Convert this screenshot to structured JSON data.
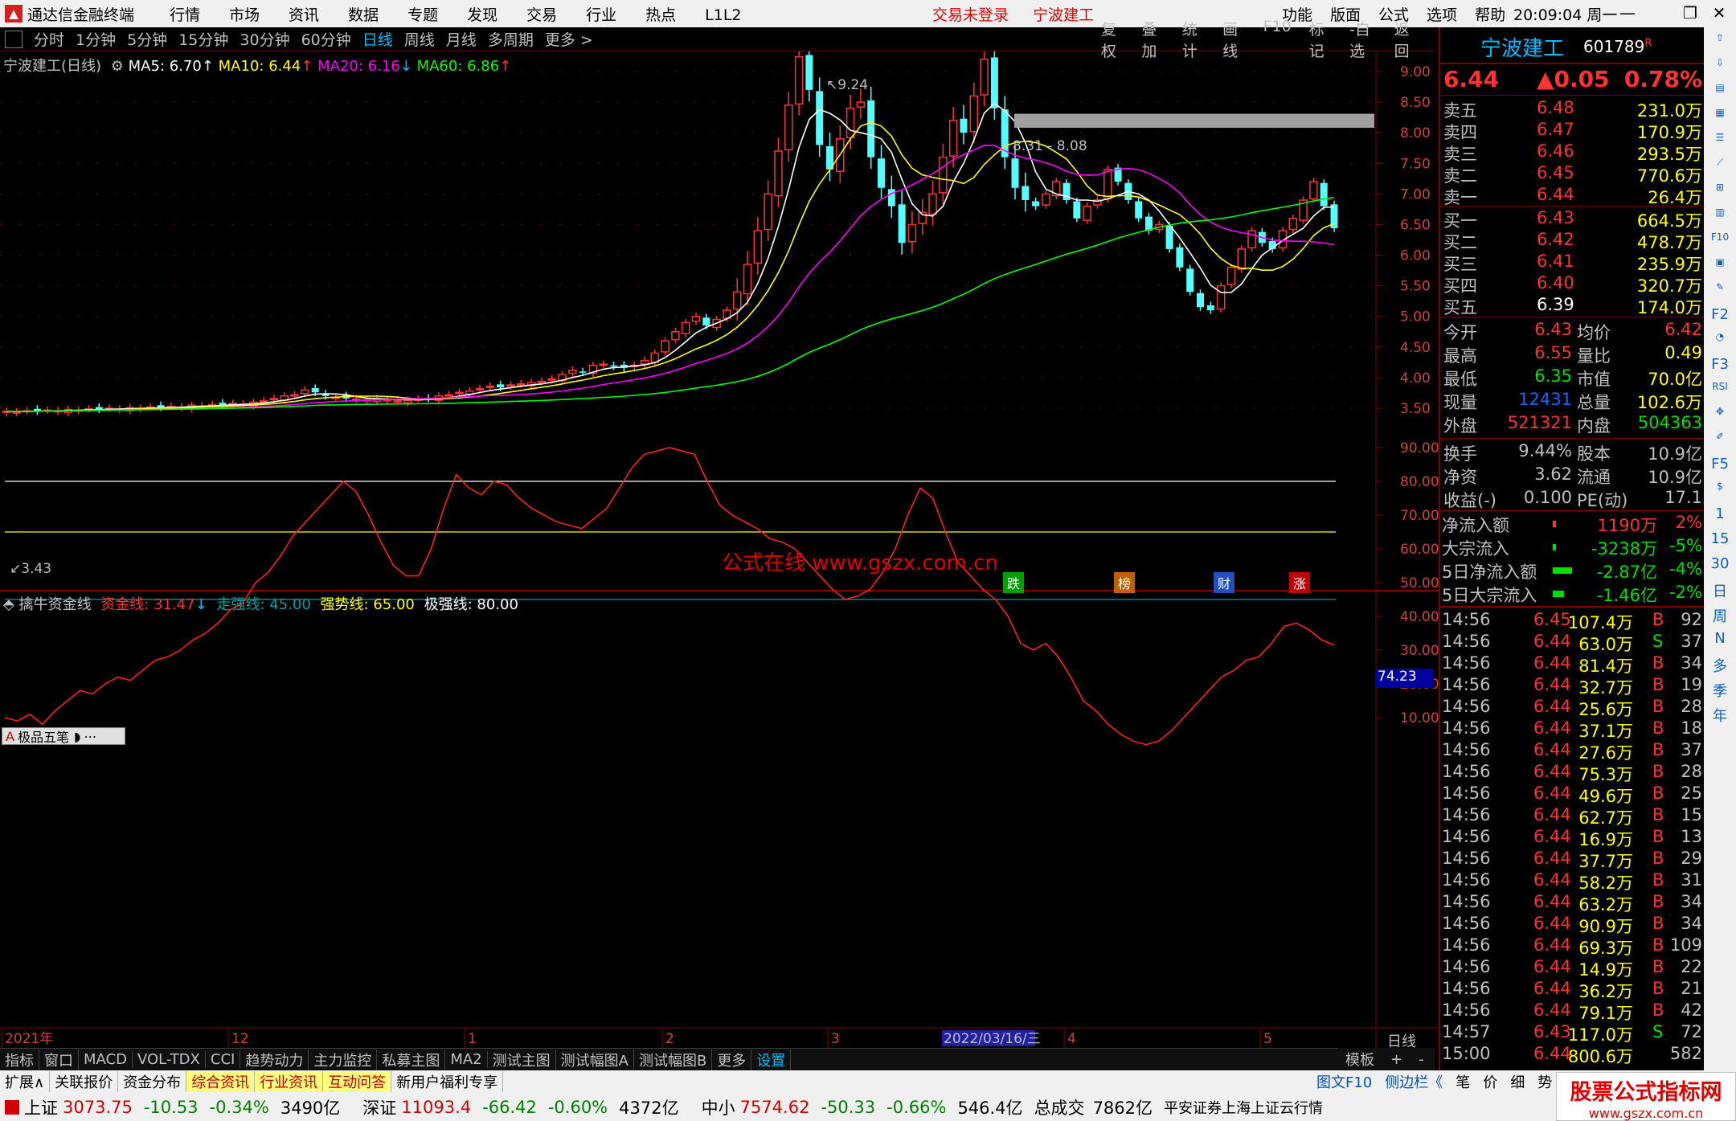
{
  "titlebar": {
    "app_name": "通达信金融终端",
    "menu": [
      "行情",
      "市场",
      "资讯",
      "数据",
      "专题",
      "发现",
      "交易",
      "行业",
      "热点",
      "L1L2"
    ],
    "trade_status": "交易未登录",
    "stock_name": "宁波建工",
    "right_menu": [
      "功能",
      "版面",
      "公式",
      "选项",
      "帮助"
    ],
    "clock": "20:09:04",
    "weekday": "周一"
  },
  "toolbar": {
    "periods": [
      "分时",
      "1分钟",
      "5分钟",
      "15分钟",
      "30分钟",
      "60分钟",
      "日线",
      "周线",
      "月线",
      "多周期",
      "更多 >"
    ],
    "active_period": "日线",
    "right_tools": [
      "复权",
      "叠加",
      "统计",
      "画线",
      "F10",
      "标记",
      "-自选",
      "返回"
    ]
  },
  "main_chart": {
    "title": "宁波建工(日线)",
    "ma5": "MA5: 6.70",
    "ma10": "MA10: 6.44",
    "ma20": "MA20: 6.16",
    "ma60": "MA60: 6.86",
    "high_label": "9.24",
    "low_label": "3.43",
    "range_label": "8.31 - 8.08",
    "watermark": "公式在线  www.gszx.com.cn",
    "event_badges": [
      {
        "label": "跌",
        "color": "#00a000"
      },
      {
        "label": "榜",
        "color": "#c06000"
      },
      {
        "label": "财",
        "color": "#2050c0"
      },
      {
        "label": "涨",
        "color": "#c00000"
      }
    ],
    "colors": {
      "ma5": "#ffffff",
      "ma10": "#ffff00",
      "ma20": "#ff00ff",
      "ma60": "#00ff00",
      "up": "#ff3232",
      "down": "#54fcfc"
    }
  },
  "indicator": {
    "title": "擒牛资金线",
    "fund_line": "资金线: 31.47",
    "walk_line": "走强线: 45.00",
    "strong_line": "强势线: 65.00",
    "extreme_line": "极强线: 80.00",
    "current_value": "74.23",
    "panel_label": "极品五笔"
  },
  "chart_data": [
    {
      "type": "candlestick",
      "title": "宁波建工(日线)",
      "ylim": [
        3.3,
        9.3
      ],
      "y_ticks": [
        "9.00",
        "8.50",
        "8.00",
        "7.50",
        "7.00",
        "6.50",
        "6.00",
        "5.50",
        "5.00",
        "4.50",
        "4.00",
        "3.50"
      ],
      "x_labels": [
        "2021年",
        "12",
        "1",
        "2",
        "3",
        "2022/03/16/三",
        "4",
        "5"
      ],
      "close": [
        3.45,
        3.44,
        3.46,
        3.45,
        3.47,
        3.46,
        3.48,
        3.47,
        3.49,
        3.48,
        3.5,
        3.49,
        3.51,
        3.5,
        3.52,
        3.51,
        3.53,
        3.52,
        3.55,
        3.54,
        3.56,
        3.55,
        3.58,
        3.57,
        3.6,
        3.62,
        3.66,
        3.7,
        3.72,
        3.8,
        3.76,
        3.7,
        3.68,
        3.66,
        3.65,
        3.64,
        3.66,
        3.64,
        3.62,
        3.63,
        3.65,
        3.66,
        3.7,
        3.72,
        3.76,
        3.78,
        3.82,
        3.86,
        3.84,
        3.88,
        3.9,
        3.92,
        3.94,
        3.98,
        4.05,
        4.12,
        4.1,
        4.2,
        4.22,
        4.18,
        4.16,
        4.2,
        4.28,
        4.4,
        4.6,
        4.75,
        4.9,
        5.0,
        4.85,
        4.95,
        5.1,
        5.4,
        5.85,
        6.4,
        7.0,
        7.7,
        8.45,
        9.24,
        8.7,
        7.8,
        7.4,
        7.9,
        8.4,
        8.5,
        7.6,
        7.1,
        6.8,
        6.2,
        6.5,
        6.7,
        7.0,
        7.6,
        8.2,
        8.0,
        8.6,
        9.2,
        8.4,
        7.6,
        7.1,
        6.9,
        6.8,
        7.0,
        7.2,
        6.9,
        6.6,
        6.8,
        6.9,
        7.4,
        7.2,
        6.9,
        6.6,
        6.4,
        6.5,
        6.1,
        5.8,
        5.4,
        5.15,
        5.1,
        5.5,
        5.8,
        6.1,
        6.4,
        6.2,
        6.1,
        6.4,
        6.6,
        6.9,
        7.2,
        6.8,
        6.44
      ],
      "ma_lines": {
        "MA5": 6.7,
        "MA10": 6.44,
        "MA20": 6.16,
        "MA60": 6.86
      }
    },
    {
      "type": "line",
      "title": "擒牛资金线",
      "ylim": [
        0,
        95
      ],
      "y_ticks": [
        "90.00",
        "80.00",
        "70.00",
        "60.00",
        "50.00",
        "40.00",
        "30.00",
        "20.00",
        "10.00"
      ],
      "series": [
        {
          "name": "资金线",
          "values": [
            10,
            9,
            11,
            8,
            12,
            15,
            18,
            17,
            20,
            22,
            21,
            24,
            27,
            28,
            30,
            33,
            35,
            38,
            42,
            44,
            50,
            53,
            58,
            64,
            68,
            72,
            76,
            80,
            77,
            70,
            62,
            55,
            52,
            52,
            60,
            72,
            82,
            78,
            76,
            80,
            79,
            75,
            72,
            70,
            68,
            67,
            66,
            69,
            72,
            78,
            84,
            88,
            89,
            90,
            89,
            88,
            80,
            73,
            70,
            68,
            66,
            63,
            62,
            60,
            56,
            52,
            48,
            45,
            46,
            48,
            53,
            60,
            70,
            78,
            75,
            65,
            56,
            52,
            48,
            45,
            40,
            32,
            30,
            32,
            28,
            22,
            15,
            12,
            8,
            5,
            3,
            2,
            3,
            6,
            10,
            14,
            18,
            22,
            24,
            27,
            28,
            32,
            37,
            38,
            36,
            33,
            31.47
          ]
        }
      ],
      "reference_lines": [
        {
          "name": "走强线",
          "value": 45
        },
        {
          "name": "强势线",
          "value": 65
        },
        {
          "name": "极强线",
          "value": 80
        }
      ]
    }
  ],
  "quote": {
    "name": "宁波建工",
    "code": "601789",
    "code_mark": "R",
    "price": "6.44",
    "change": "▲0.05",
    "change_pct": "0.78%",
    "sells": [
      {
        "label": "卖五",
        "price": "6.48",
        "vol": "231.0万"
      },
      {
        "label": "卖四",
        "price": "6.47",
        "vol": "170.9万"
      },
      {
        "label": "卖三",
        "price": "6.46",
        "vol": "293.5万"
      },
      {
        "label": "卖二",
        "price": "6.45",
        "vol": "770.6万"
      },
      {
        "label": "卖一",
        "price": "6.44",
        "vol": "26.4万"
      }
    ],
    "buys": [
      {
        "label": "买一",
        "price": "6.43",
        "vol": "664.5万"
      },
      {
        "label": "买二",
        "price": "6.42",
        "vol": "478.7万"
      },
      {
        "label": "买三",
        "price": "6.41",
        "vol": "235.9万"
      },
      {
        "label": "买四",
        "price": "6.40",
        "vol": "320.7万"
      },
      {
        "label": "买五",
        "price": "6.39",
        "vol": "174.0万"
      }
    ],
    "stats": [
      {
        "l1": "今开",
        "v1": "6.43",
        "c1": "#ff3232",
        "l2": "均价",
        "v2": "6.42",
        "c2": "#ff3232"
      },
      {
        "l1": "最高",
        "v1": "6.55",
        "c1": "#ff3232",
        "l2": "量比",
        "v2": "0.49",
        "c2": "#ffff00"
      },
      {
        "l1": "最低",
        "v1": "6.35",
        "c1": "#00e000",
        "l2": "市值",
        "v2": "70.0亿",
        "c2": "#ffff00"
      },
      {
        "l1": "现量",
        "v1": "12431",
        "c1": "#2060ff",
        "l2": "总量",
        "v2": "102.6万",
        "c2": "#ffff00"
      },
      {
        "l1": "外盘",
        "v1": "521321",
        "c1": "#ff3232",
        "l2": "内盘",
        "v2": "504363",
        "c2": "#00e000"
      }
    ],
    "stats2": [
      {
        "l1": "换手",
        "v1": "9.44%",
        "l2": "股本",
        "v2": "10.9亿"
      },
      {
        "l1": "净资",
        "v1": "3.62",
        "l2": "流通",
        "v2": "10.9亿"
      },
      {
        "l1": "收益(-)",
        "v1": "0.100",
        "l2": "PE(动)",
        "v2": "17.1"
      }
    ],
    "flows": [
      {
        "label": "净流入额",
        "value": "1190万",
        "pct": "2%",
        "color": "#ff3232",
        "bar": 0.1
      },
      {
        "label": "大宗流入",
        "value": "-3238万",
        "pct": "-5%",
        "color": "#00e000",
        "bar": 0.1
      },
      {
        "label": "5日净流入额",
        "value": "-2.87亿",
        "pct": "-4%",
        "color": "#00e000",
        "bar": 0.6
      },
      {
        "label": "5日大宗流入",
        "value": "-1.46亿",
        "pct": "-2%",
        "color": "#00e000",
        "bar": 0.35
      }
    ],
    "ticks": [
      {
        "t": "14:56",
        "p": "6.45",
        "v": "107.4万",
        "s": "B",
        "n": "92"
      },
      {
        "t": "14:56",
        "p": "6.44",
        "v": "63.0万",
        "s": "S",
        "n": "37"
      },
      {
        "t": "14:56",
        "p": "6.44",
        "v": "81.4万",
        "s": "B",
        "n": "34"
      },
      {
        "t": "14:56",
        "p": "6.44",
        "v": "32.7万",
        "s": "B",
        "n": "19"
      },
      {
        "t": "14:56",
        "p": "6.44",
        "v": "25.6万",
        "s": "B",
        "n": "28"
      },
      {
        "t": "14:56",
        "p": "6.44",
        "v": "37.1万",
        "s": "B",
        "n": "18"
      },
      {
        "t": "14:56",
        "p": "6.44",
        "v": "27.6万",
        "s": "B",
        "n": "37"
      },
      {
        "t": "14:56",
        "p": "6.44",
        "v": "75.3万",
        "s": "B",
        "n": "28"
      },
      {
        "t": "14:56",
        "p": "6.44",
        "v": "49.6万",
        "s": "B",
        "n": "25"
      },
      {
        "t": "14:56",
        "p": "6.44",
        "v": "62.7万",
        "s": "B",
        "n": "15"
      },
      {
        "t": "14:56",
        "p": "6.44",
        "v": "16.9万",
        "s": "B",
        "n": "13"
      },
      {
        "t": "14:56",
        "p": "6.44",
        "v": "37.7万",
        "s": "B",
        "n": "29"
      },
      {
        "t": "14:56",
        "p": "6.44",
        "v": "58.2万",
        "s": "B",
        "n": "31"
      },
      {
        "t": "14:56",
        "p": "6.44",
        "v": "63.2万",
        "s": "B",
        "n": "34"
      },
      {
        "t": "14:56",
        "p": "6.44",
        "v": "90.9万",
        "s": "B",
        "n": "34"
      },
      {
        "t": "14:56",
        "p": "6.44",
        "v": "69.3万",
        "s": "B",
        "n": "109"
      },
      {
        "t": "14:56",
        "p": "6.44",
        "v": "14.9万",
        "s": "B",
        "n": "22"
      },
      {
        "t": "14:56",
        "p": "6.44",
        "v": "36.2万",
        "s": "B",
        "n": "21"
      },
      {
        "t": "14:56",
        "p": "6.44",
        "v": "79.1万",
        "s": "B",
        "n": "42"
      },
      {
        "t": "14:57",
        "p": "6.43",
        "v": "117.0万",
        "s": "S",
        "n": "72"
      },
      {
        "t": "15:00",
        "p": "6.44",
        "v": "800.6万",
        "s": "",
        "n": "582"
      }
    ]
  },
  "bottom_tabs": [
    "指标",
    "窗口",
    "MACD",
    "VOL-TDX",
    "CCI",
    "趋势动力",
    "主力监控",
    "私募主图",
    "MA2",
    "测试主图",
    "测试幅图A",
    "测试幅图B",
    "更多",
    "设置"
  ],
  "bottom_right": [
    "模板",
    "+",
    "-"
  ],
  "period_label": "日线",
  "low_tabs": [
    "扩展∧",
    "关联报价",
    "资金分布",
    "综合资讯",
    "行业资讯",
    "互动问答",
    "新用户福利专享"
  ],
  "low_right": [
    "图文F10",
    "侧边栏《",
    "笔",
    "价",
    "细",
    "势"
  ],
  "statusbar": {
    "sh_label": "上证",
    "sh_val": "3073.75",
    "sh_chg": "-10.53",
    "sh_pct": "-0.34%",
    "sh_amt": "3490亿",
    "sz_label": "深证",
    "sz_val": "11093.4",
    "sz_chg": "-66.42",
    "sz_pct": "-0.60%",
    "sz_amt": "4372亿",
    "zx_label": "中小",
    "zx_val": "7574.62",
    "zx_chg": "-50.33",
    "zx_pct": "-0.66%",
    "zx_amt": "546.4亿",
    "total_label": "总成交",
    "total_val": "7862亿",
    "broker": "平安证券上海上证云行情",
    "brand": "股票公式指标网",
    "brand_url": "www.gszx.com.cn"
  },
  "side_icons": [
    "up-arrow",
    "down-arrow",
    "chart",
    "grid",
    "list",
    "line",
    "candle",
    "table",
    "F10",
    "chart2",
    "note",
    "F2",
    "pie",
    "F3",
    "RSI",
    "move",
    "pen",
    "F5",
    "dollar",
    "1",
    "15",
    "30",
    "日",
    "周",
    "N",
    "多",
    "季",
    "年"
  ]
}
